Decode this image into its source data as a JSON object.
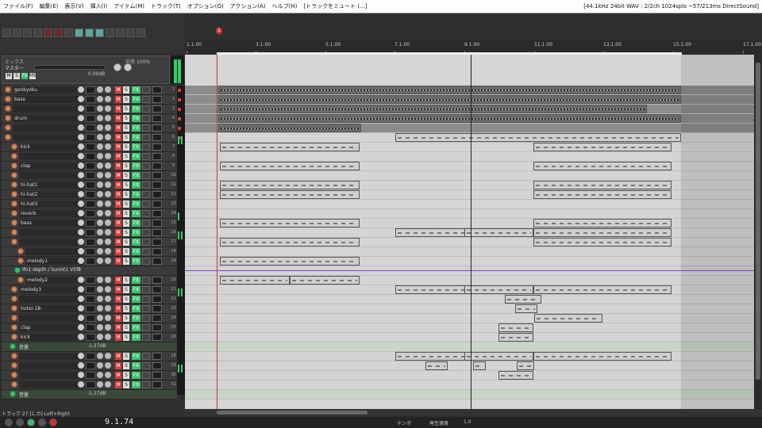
{
  "menubar": {
    "items": [
      "ファイル(F)",
      "編集(E)",
      "表示(V)",
      "挿入(I)",
      "アイテム(M)",
      "トラック(T)",
      "オプション(O)",
      "アクション(A)",
      "ヘルプ(H)",
      "[トラックをミュート (...]"
    ],
    "status": "[44.1kHz 24bit WAV : 2/2ch 1024spls ~57/213ms DirectSound]"
  },
  "master": {
    "label": "ミックス",
    "name": "マスター",
    "volume": "0.00dB",
    "pan": "中央",
    "pan_pct": "100%",
    "m": "M",
    "s": "S",
    "fx": "FX",
    "ms": "MS"
  },
  "marker": "1",
  "ruler": {
    "bars": [
      "1.1.00",
      "3.1.00",
      "5.1.00",
      "7.1.00",
      "9.1.00",
      "11.1.00",
      "13.1.00",
      "15.1.00",
      "17.1.00"
    ]
  },
  "tracks": [
    {
      "name": "genkyoku",
      "num": "1"
    },
    {
      "name": "bass",
      "num": "2"
    },
    {
      "name": "",
      "num": "3"
    },
    {
      "name": "drum",
      "num": "4"
    },
    {
      "name": "",
      "num": "5"
    },
    {
      "name": "",
      "num": "6"
    },
    {
      "name": "kick",
      "num": "7"
    },
    {
      "name": "",
      "num": "8"
    },
    {
      "name": "clap",
      "num": "9"
    },
    {
      "name": "",
      "num": "10"
    },
    {
      "name": "hi-hat1",
      "num": "11"
    },
    {
      "name": "hi-hat2",
      "num": "12"
    },
    {
      "name": "hi-hat3",
      "num": "13"
    },
    {
      "name": "reverb",
      "num": "14"
    },
    {
      "name": "bass",
      "num": "15"
    },
    {
      "name": "",
      "num": "16"
    },
    {
      "name": "",
      "num": "17"
    },
    {
      "name": "",
      "num": "18"
    },
    {
      "name": "melody1",
      "num": "19"
    },
    {
      "name": "lfo1 depth / tunint1 VSTi",
      "num": "",
      "envelope": true,
      "value": "0"
    },
    {
      "name": "melody2",
      "num": "20"
    },
    {
      "name": "melody3",
      "num": "21"
    },
    {
      "name": "",
      "num": "22"
    },
    {
      "name": "hutoi-18-",
      "num": "23"
    },
    {
      "name": "",
      "num": "24"
    },
    {
      "name": "clap",
      "num": "25"
    },
    {
      "name": "kick",
      "num": "26"
    },
    {
      "name": "音量",
      "num": "",
      "volume": true,
      "value": "-1.27dB"
    },
    {
      "name": "",
      "num": "28"
    },
    {
      "name": "",
      "num": "29"
    },
    {
      "name": "",
      "num": "30"
    },
    {
      "name": "",
      "num": "31"
    },
    {
      "name": "音量",
      "num": "",
      "volume": true,
      "value": "-1.27dB"
    }
  ],
  "track_buttons": {
    "m": "M",
    "s": "S",
    "fx": "FX"
  },
  "statusline": "トラック 27 [1.カ] Left+Right",
  "transport": {
    "position": "9.1.74",
    "t1": "テンポ",
    "t2": "再生速度",
    "t3": "1.0"
  }
}
